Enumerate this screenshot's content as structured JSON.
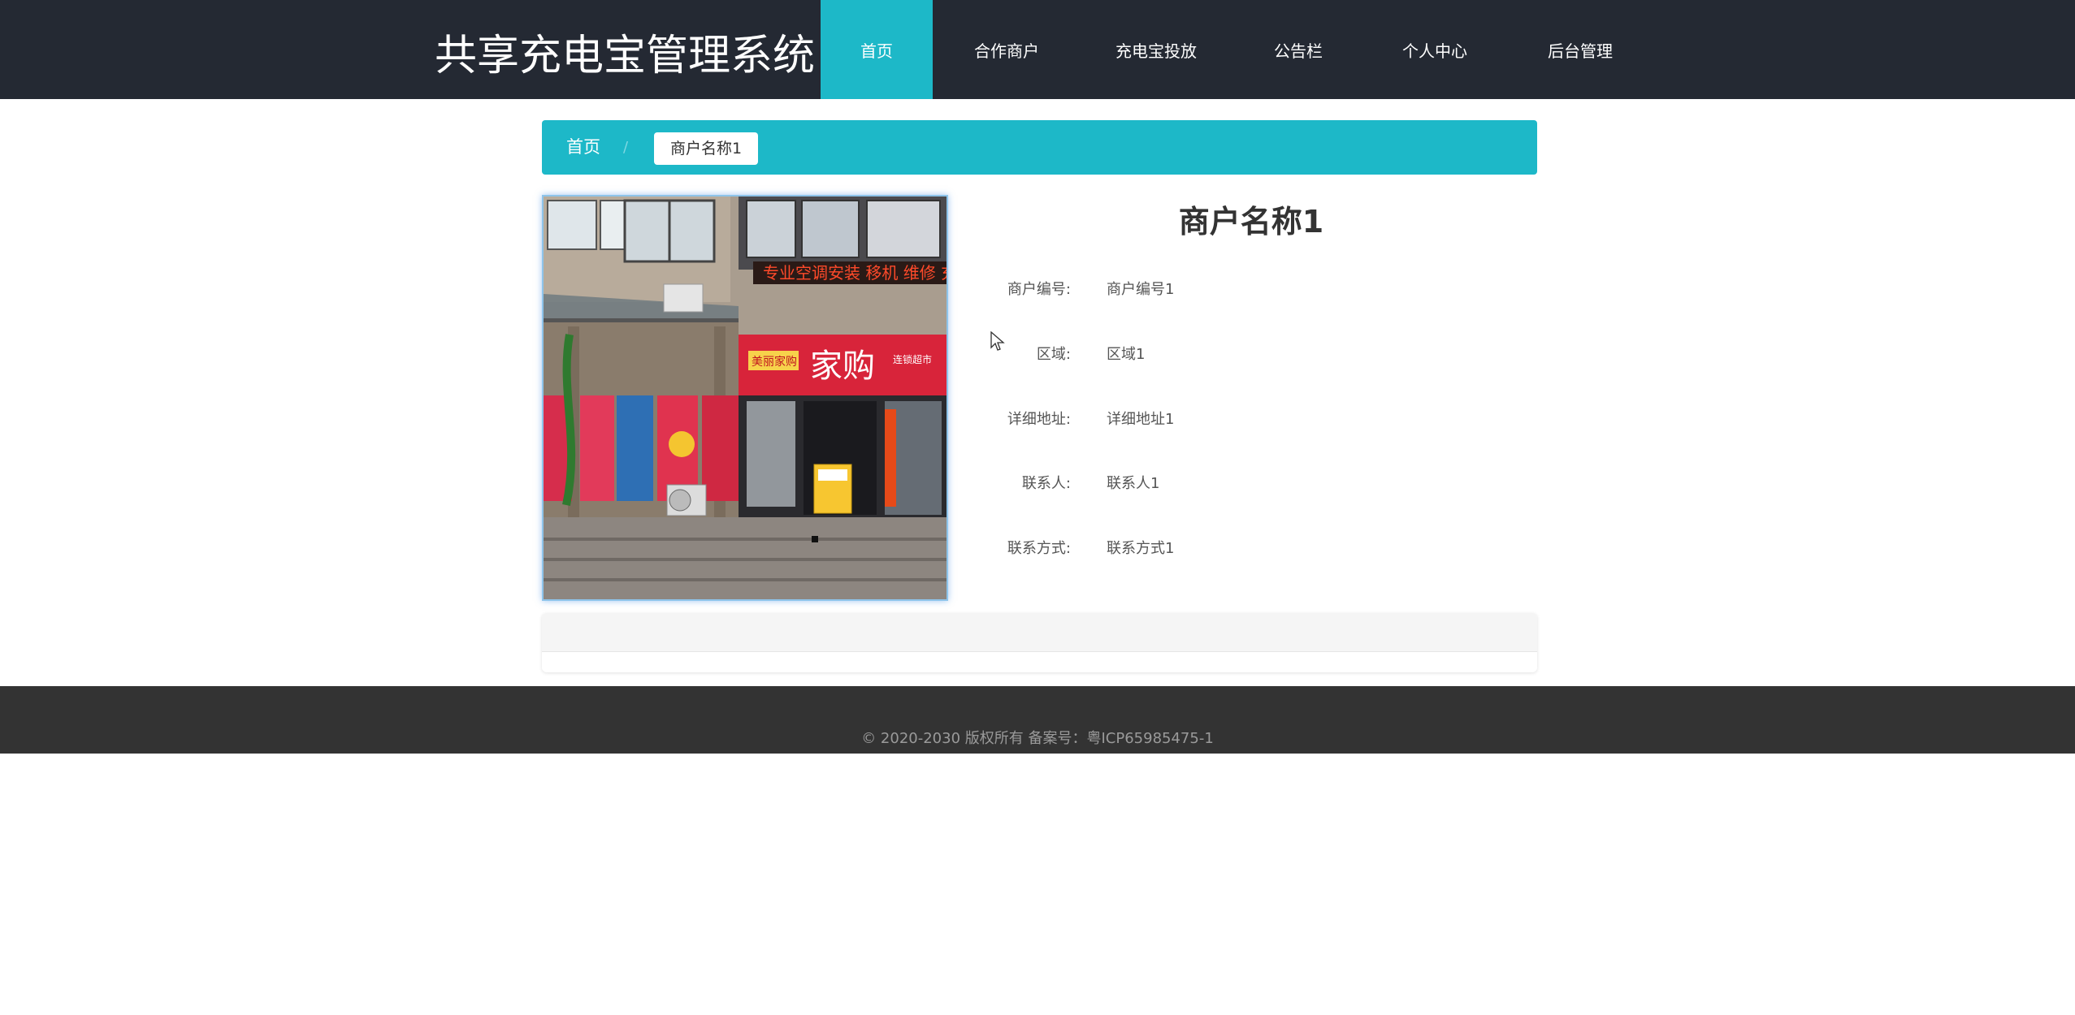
{
  "header": {
    "site_title": "共享充电宝管理系统",
    "nav": [
      {
        "label": "首页",
        "active": true
      },
      {
        "label": "合作商户",
        "active": false
      },
      {
        "label": "充电宝投放",
        "active": false
      },
      {
        "label": "公告栏",
        "active": false
      },
      {
        "label": "个人中心",
        "active": false
      },
      {
        "label": "后台管理",
        "active": false
      }
    ],
    "accent_color": "#1db8c8",
    "background_color": "#242933"
  },
  "breadcrumb": {
    "home": "首页",
    "separator": "/",
    "current": "商户名称1"
  },
  "detail": {
    "title": "商户名称1",
    "fields": [
      {
        "label": "商户编号:",
        "value": "商户编号1"
      },
      {
        "label": "区域:",
        "value": "区域1"
      },
      {
        "label": "详细地址:",
        "value": "详细地址1"
      },
      {
        "label": "联系人:",
        "value": "联系人1"
      },
      {
        "label": "联系方式:",
        "value": "联系方式1"
      }
    ],
    "photo_signs": {
      "led_banner": "专业空调安装 移机 维修 充",
      "store_logo": "家购",
      "store_tag": "美丽家购",
      "store_right": "连锁超市"
    }
  },
  "footer": {
    "text": "© 2020-2030 版权所有 备案号：粤ICP65985475-1"
  }
}
